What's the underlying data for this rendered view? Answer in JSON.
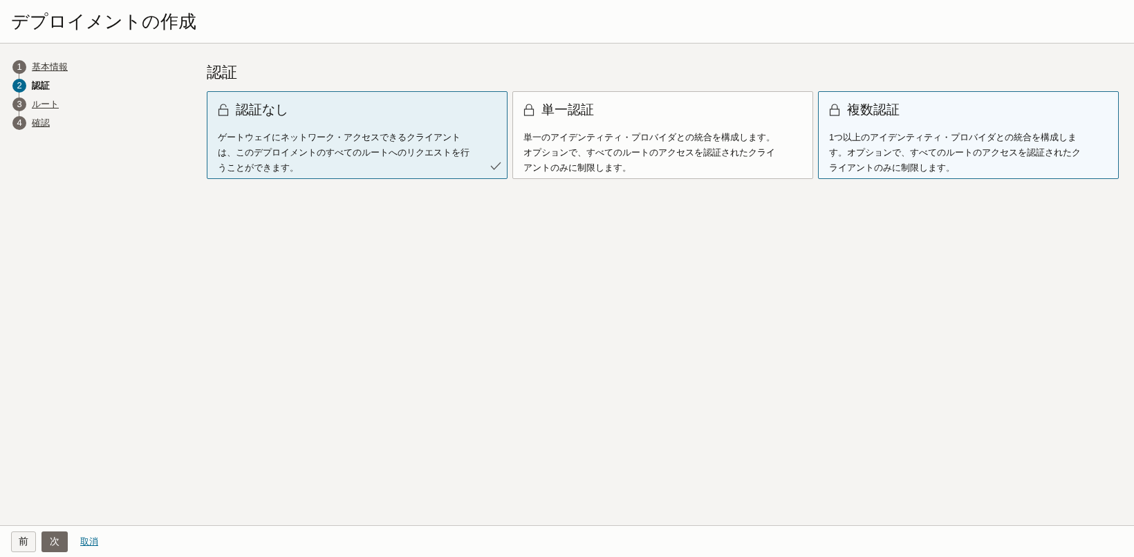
{
  "header": {
    "title": "デプロイメントの作成"
  },
  "steps": [
    {
      "number": "1",
      "label": "基本情報",
      "selected": false
    },
    {
      "number": "2",
      "label": "認証",
      "selected": true
    },
    {
      "number": "3",
      "label": "ルート",
      "selected": false
    },
    {
      "number": "4",
      "label": "確認",
      "selected": false
    }
  ],
  "section": {
    "title": "認証"
  },
  "options": [
    {
      "kind": "unlocked",
      "title": "認証なし",
      "description": "ゲートウェイにネットワーク・アクセスできるクライアントは、このデプロイメントのすべてのルートへのリクエストを行うことができます。",
      "selected": true,
      "hovered": false
    },
    {
      "kind": "locked",
      "title": "単一認証",
      "description": "単一のアイデンティティ・プロバイダとの統合を構成します。オプションで、すべてのルートのアクセスを認証されたクライアントのみに制限します。",
      "selected": false,
      "hovered": false
    },
    {
      "kind": "locked",
      "title": "複数認証",
      "description": "1つ以上のアイデンティティ・プロバイダとの統合を構成します。オプションで、すべてのルートのアクセスを認証されたクライアントのみに制限します。",
      "selected": false,
      "hovered": true
    }
  ],
  "footer": {
    "previous": "前",
    "next": "次",
    "cancel": "取消"
  }
}
